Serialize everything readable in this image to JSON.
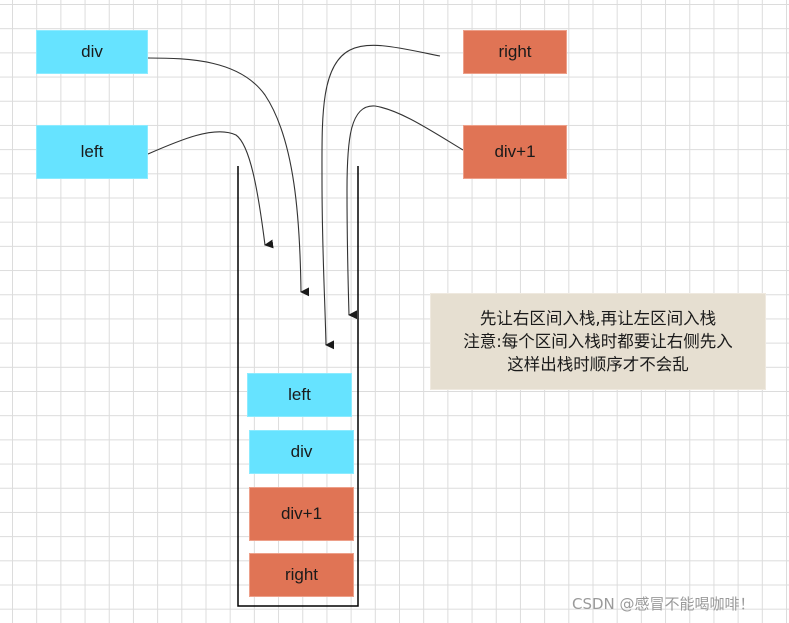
{
  "input_nodes": [
    {
      "label": "div",
      "color": "#66e3ff"
    },
    {
      "label": "left",
      "color": "#66e3ff"
    },
    {
      "label": "right",
      "color": "#e07455"
    },
    {
      "label": "div+1",
      "color": "#e07455"
    }
  ],
  "stack": {
    "items_top_to_bottom": [
      {
        "label": "left",
        "color": "#66e3ff"
      },
      {
        "label": "div",
        "color": "#66e3ff"
      },
      {
        "label": "div+1",
        "color": "#e07455"
      },
      {
        "label": "right",
        "color": "#e07455"
      }
    ]
  },
  "note": {
    "lines": [
      "先让右区间入栈,再让左区间入栈",
      "注意:每个区间入栈时都要让右侧先入",
      "这样出栈时顺序才不会乱"
    ],
    "background": "#e6dfd1"
  },
  "watermark": "CSDN @感冒不能喝咖啡！"
}
